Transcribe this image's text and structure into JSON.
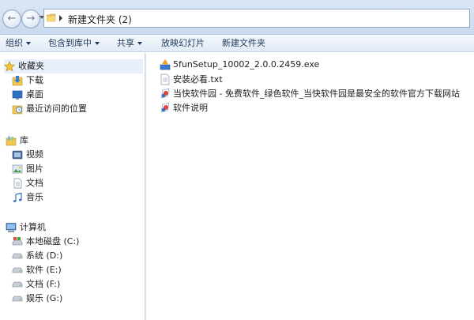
{
  "address": {
    "path": "新建文件夹 (2)"
  },
  "toolbar": {
    "organize": "组织",
    "include_in_library": "包含到库中",
    "share": "共享",
    "slideshow": "放映幻灯片",
    "new_folder": "新建文件夹"
  },
  "nav": {
    "favorites": {
      "label": "收藏夹",
      "items": [
        "下载",
        "桌面",
        "最近访问的位置"
      ]
    },
    "libraries": {
      "label": "库",
      "items": [
        "视频",
        "图片",
        "文档",
        "音乐"
      ]
    },
    "computer": {
      "label": "计算机",
      "drives": [
        "本地磁盘 (C:)",
        "系统 (D:)",
        "软件 (E:)",
        "文档 (F:)",
        "娱乐 (G:)"
      ]
    }
  },
  "files": [
    {
      "name": "5funSetup_10002_2.0.0.2459.exe",
      "icon": "installer-icon"
    },
    {
      "name": "安装必看.txt",
      "icon": "text-file-icon"
    },
    {
      "name": "当快软件园 - 免费软件_绿色软件_当快软件园是最安全的软件官方下载网站",
      "icon": "internet-shortcut-icon"
    },
    {
      "name": "软件说明",
      "icon": "internet-shortcut-icon"
    }
  ],
  "colors": {
    "toolbar_text": "#1e395b",
    "selected_nav_bg": "#e8f1fb",
    "addressbar_bg": "#c9daf0"
  }
}
